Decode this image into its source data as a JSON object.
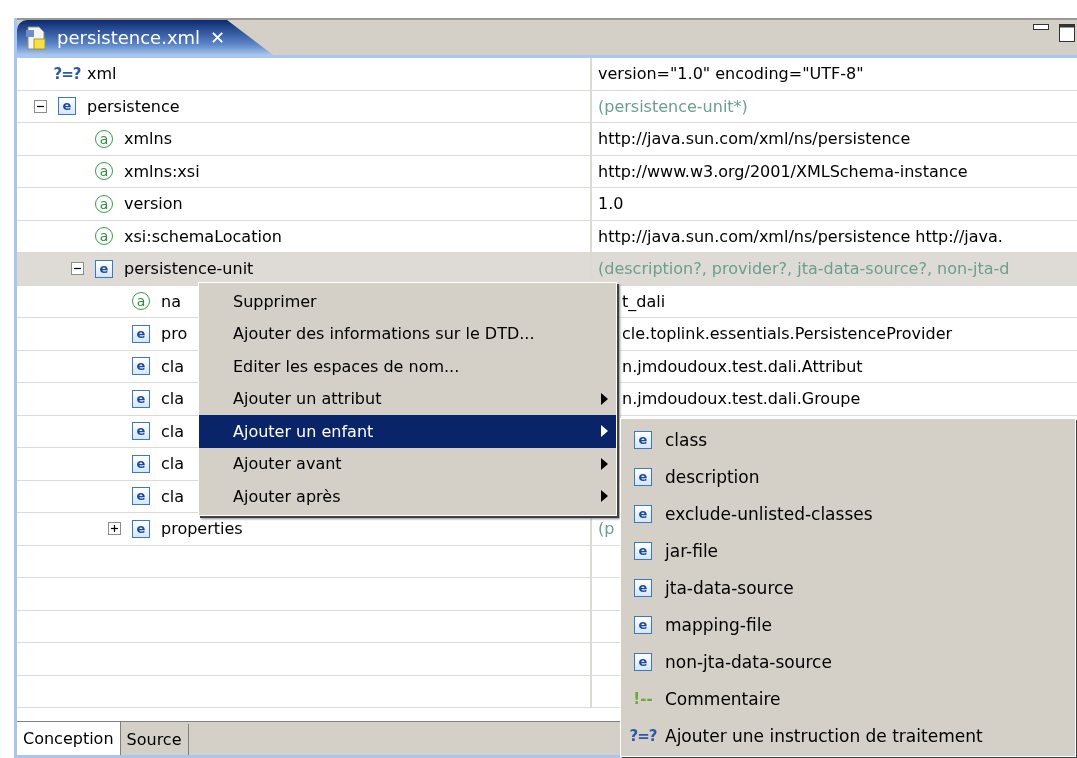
{
  "editor_tab": {
    "label": "persistence.xml",
    "close": "✕",
    "selected": true
  },
  "tree": [
    {
      "kind": "instruction",
      "icon": "?=?",
      "name": "xml",
      "value": "version=\"1.0\" encoding=\"UTF-8\"",
      "model": false,
      "selected": false
    },
    {
      "kind": "element",
      "icon": "e",
      "name": "persistence",
      "value": "(persistence-unit*)",
      "model": true,
      "selected": false,
      "expanded": true,
      "children": [
        {
          "kind": "attribute",
          "icon": "a",
          "name": "xmlns",
          "value": "http://java.sun.com/xml/ns/persistence",
          "model": false,
          "selected": false
        },
        {
          "kind": "attribute",
          "icon": "a",
          "name": "xmlns:xsi",
          "value": "http://www.w3.org/2001/XMLSchema-instance",
          "model": false,
          "selected": false
        },
        {
          "kind": "attribute",
          "icon": "a",
          "name": "version",
          "value": "1.0",
          "model": false,
          "selected": false
        },
        {
          "kind": "attribute",
          "icon": "a",
          "name": "xsi:schemaLocation",
          "value": "http://java.sun.com/xml/ns/persistence http://java.",
          "model": false,
          "selected": false
        },
        {
          "kind": "element",
          "icon": "e",
          "name": "persistence-unit",
          "value": "(description?, provider?, jta-data-source?, non-jta-d",
          "model": true,
          "selected": true,
          "expanded": true,
          "children": [
            {
              "kind": "attribute",
              "icon": "a",
              "name": "na",
              "value": "t_dali",
              "model": false,
              "selected": false
            },
            {
              "kind": "element",
              "icon": "e",
              "name": "pro",
              "value": "cle.toplink.essentials.PersistenceProvider",
              "model": false,
              "selected": false
            },
            {
              "kind": "element",
              "icon": "e",
              "name": "cla",
              "value": "n.jmdoudoux.test.dali.Attribut",
              "model": false,
              "selected": false
            },
            {
              "kind": "element",
              "icon": "e",
              "name": "cla",
              "value": "n.jmdoudoux.test.dali.Groupe",
              "model": false,
              "selected": false
            },
            {
              "kind": "element",
              "icon": "e",
              "name": "cla",
              "selected": false
            },
            {
              "kind": "element",
              "icon": "e",
              "name": "cla",
              "selected": false
            },
            {
              "kind": "element",
              "icon": "e",
              "name": "cla",
              "selected": false
            },
            {
              "kind": "element",
              "icon": "e",
              "name": "properties",
              "value": "(p",
              "model": true,
              "selected": false,
              "expanded": false
            }
          ]
        }
      ]
    }
  ],
  "context_menu": [
    {
      "label": "Supprimer",
      "submenu": false,
      "selected": false
    },
    {
      "label": "Ajouter des informations sur le DTD...",
      "submenu": false,
      "selected": false
    },
    {
      "label": "Editer les espaces de nom...",
      "submenu": false,
      "selected": false
    },
    {
      "label": "Ajouter un attribut",
      "submenu": true,
      "selected": false
    },
    {
      "label": "Ajouter un enfant",
      "submenu": true,
      "selected": true
    },
    {
      "label": "Ajouter avant",
      "submenu": true,
      "selected": false
    },
    {
      "label": "Ajouter après",
      "submenu": true,
      "selected": false
    }
  ],
  "submenu": [
    {
      "kind": "element",
      "icon": "e",
      "label": "class"
    },
    {
      "kind": "element",
      "icon": "e",
      "label": "description"
    },
    {
      "kind": "element",
      "icon": "e",
      "label": "exclude-unlisted-classes"
    },
    {
      "kind": "element",
      "icon": "e",
      "label": "jar-file"
    },
    {
      "kind": "element",
      "icon": "e",
      "label": "jta-data-source"
    },
    {
      "kind": "element",
      "icon": "e",
      "label": "mapping-file"
    },
    {
      "kind": "element",
      "icon": "e",
      "label": "non-jta-data-source"
    },
    {
      "kind": "comment",
      "icon": "!--",
      "label": "Commentaire"
    },
    {
      "kind": "instruction",
      "icon": "?=?",
      "label": "Ajouter une instruction de traitement"
    }
  ],
  "bottom_tabs": [
    {
      "label": "Conception",
      "selected": true
    },
    {
      "label": "Source",
      "selected": false
    }
  ]
}
